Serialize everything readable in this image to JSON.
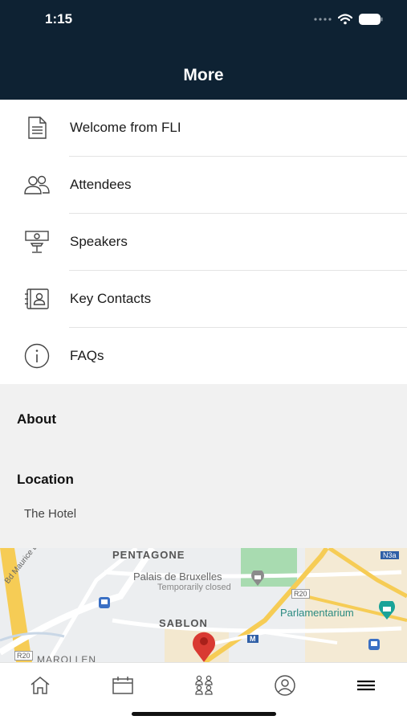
{
  "status": {
    "time": "1:15"
  },
  "header": {
    "title": "More"
  },
  "menu": {
    "items": [
      {
        "label": "Welcome from FLI",
        "icon": "document-icon"
      },
      {
        "label": "Attendees",
        "icon": "people-icon"
      },
      {
        "label": "Speakers",
        "icon": "speaker-podium-icon"
      },
      {
        "label": "Key Contacts",
        "icon": "contact-book-icon"
      },
      {
        "label": "FAQs",
        "icon": "info-icon"
      }
    ]
  },
  "about": {
    "title": "About"
  },
  "location": {
    "title": "Location",
    "venue": "The Hotel"
  },
  "map": {
    "labels": {
      "pentagone": "PENTAGONE",
      "palais": "Palais de Bruxelles",
      "temporarily_closed": "Temporarily closed",
      "sablon": "SABLON",
      "parlamentarium": "Parlamentarium",
      "bd_maurice": "Bd Maurice Lemonnier",
      "marollen": "MAROLLEN",
      "r20_a": "R20",
      "r20_b": "R20",
      "n3a": "N3a",
      "metro": "M"
    }
  },
  "tabbar": {
    "tabs": [
      {
        "icon": "home-icon"
      },
      {
        "icon": "calendar-icon"
      },
      {
        "icon": "attendees-icon"
      },
      {
        "icon": "profile-icon"
      },
      {
        "icon": "menu-icon"
      }
    ]
  },
  "colors": {
    "header_bg": "#0e2233",
    "section_bg": "#f1f1f1",
    "map_pin": "#d93a32"
  }
}
